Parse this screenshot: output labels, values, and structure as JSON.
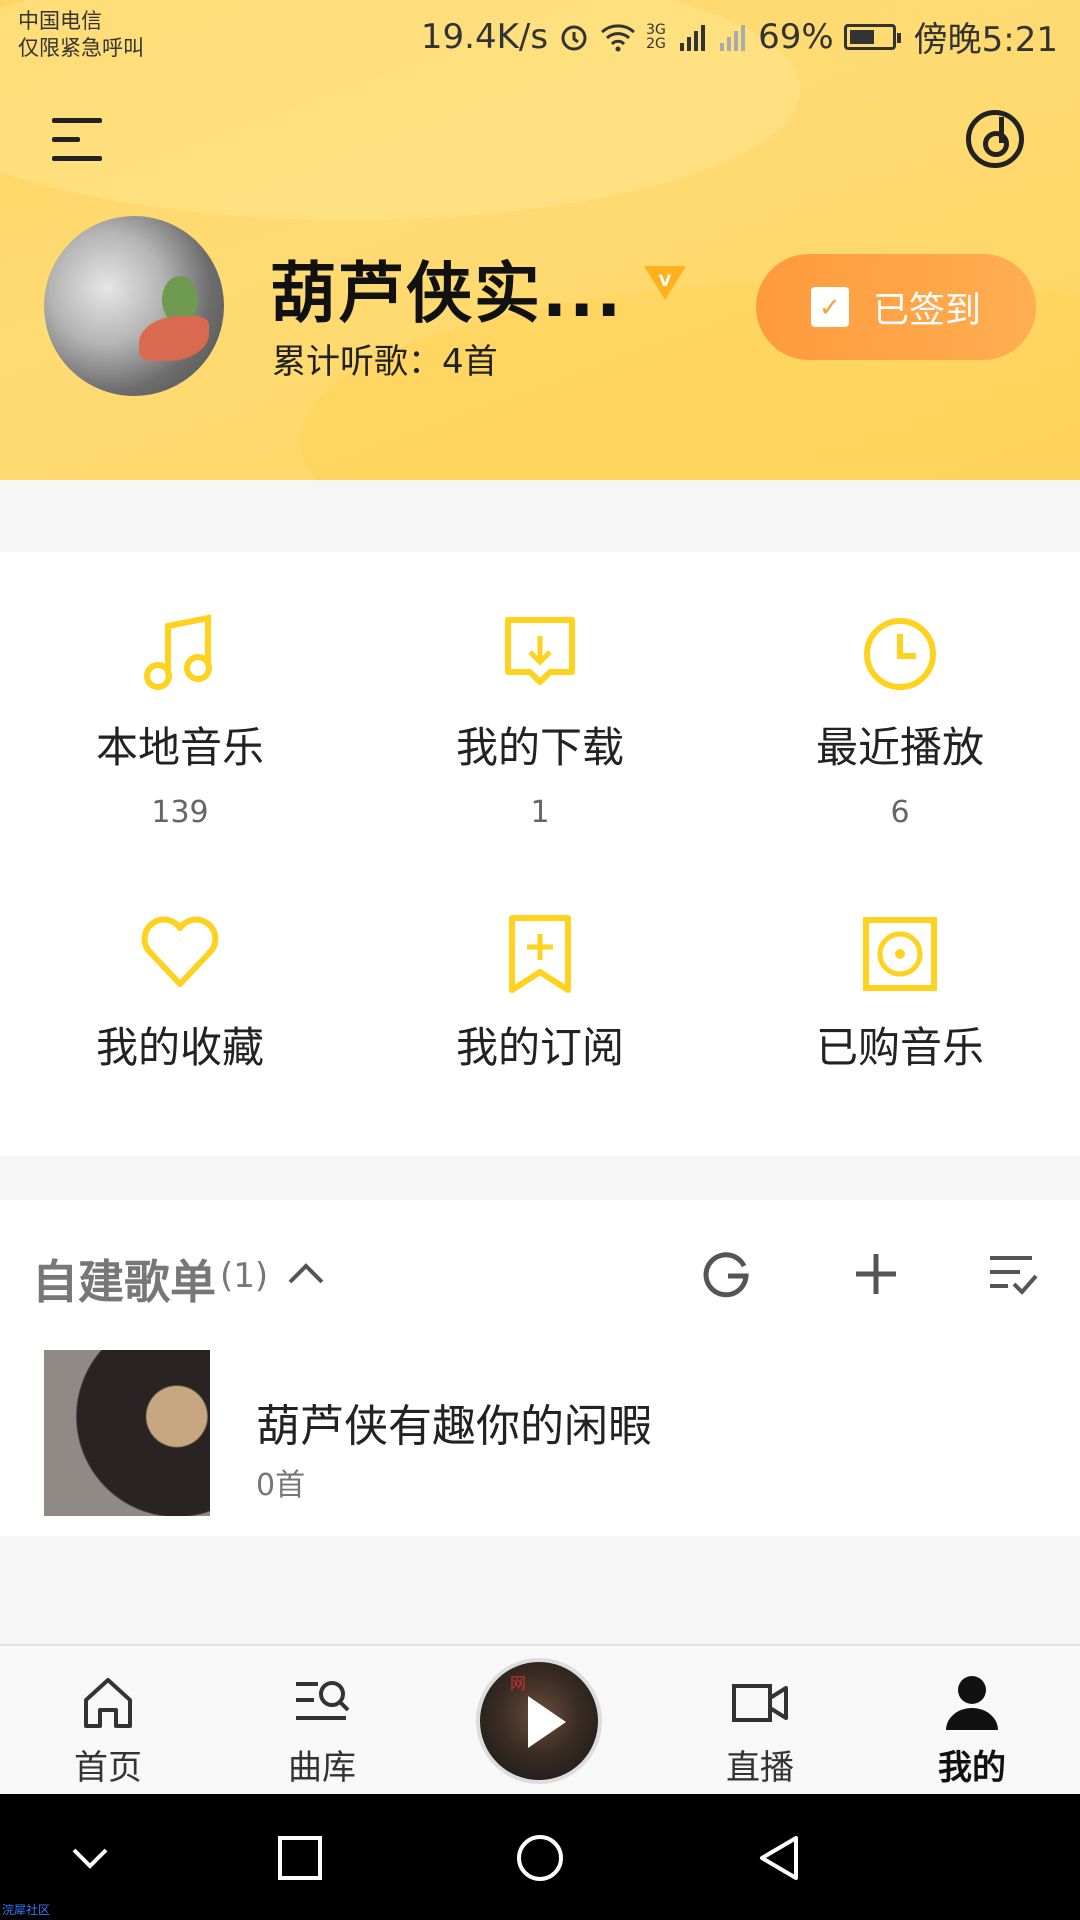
{
  "status_bar": {
    "carrier_line1": "中国电信",
    "carrier_line2": "仅限紧急呼叫",
    "net_speed": "19.4K/s",
    "network_label": "3G 2G",
    "battery": "69%",
    "time": "傍晚5:21"
  },
  "profile": {
    "username": "葫芦侠实...",
    "vip_badge": "V",
    "listen_stat": "累计听歌：4首",
    "signin_label": "已签到",
    "colors": {
      "header": "#ffd866",
      "signin": "#ff9f42",
      "accent": "#ffd21f"
    }
  },
  "features": [
    {
      "label": "本地音乐",
      "count": "139",
      "icon": "music-note-icon"
    },
    {
      "label": "我的下载",
      "count": "1",
      "icon": "download-icon"
    },
    {
      "label": "最近播放",
      "count": "6",
      "icon": "clock-icon"
    },
    {
      "label": "我的收藏",
      "count": "",
      "icon": "heart-icon"
    },
    {
      "label": "我的订阅",
      "count": "",
      "icon": "bookmark-add-icon"
    },
    {
      "label": "已购音乐",
      "count": "",
      "icon": "disc-square-icon"
    }
  ],
  "playlists": {
    "title": "自建歌单",
    "count": "(1)",
    "items": [
      {
        "name": "葫芦侠有趣你的闲暇",
        "sub": "0首"
      }
    ]
  },
  "bottom_nav": [
    {
      "label": "首页",
      "icon": "home-icon"
    },
    {
      "label": "曲库",
      "icon": "library-search-icon"
    },
    {
      "label": "",
      "icon": "play-disc-icon"
    },
    {
      "label": "直播",
      "icon": "video-camera-icon"
    },
    {
      "label": "我的",
      "icon": "person-icon",
      "active": true
    }
  ],
  "disc_text": "网",
  "watermark": "浣犀社区"
}
